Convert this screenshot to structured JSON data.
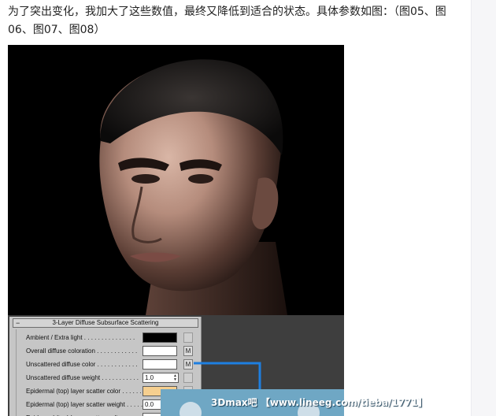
{
  "article": {
    "paragraph": "为了突出变化，我加大了这些数值，最终又降低到适合的状态。具体参数如图：（图05、图06、图07、图08）"
  },
  "rollout": {
    "title": "3-Layer Diffuse Subsurface Scattering",
    "rows": [
      {
        "label": "Ambient / Extra light . . . . . . . . . . . . . . .",
        "control": "swatch",
        "color": "#000000",
        "button": ""
      },
      {
        "label": "Overall diffuse coloration . . . . . . . . . . . .",
        "control": "swatch",
        "color": "#ffffff",
        "button": "M"
      },
      {
        "label": "Unscattered diffuse color . . . . . . . . . . . .",
        "control": "swatch",
        "color": "#ffffff",
        "button": "M"
      },
      {
        "label": "Unscattered diffuse weight . . . . . . . . . . .",
        "control": "spinner",
        "value": "1.0",
        "button": ""
      },
      {
        "label": "Epidermal (top) layer scatter color . . . . . .",
        "control": "swatch",
        "color": "#f6cf8f",
        "button": ""
      },
      {
        "label": "Epidermal (top) layer scatter weight . . . . .",
        "control": "spinner",
        "value": "0.0",
        "button": ""
      },
      {
        "label": "Epidermal (top) layer scatter radius . . . . .",
        "control": "spinner",
        "value": "",
        "button": ""
      }
    ]
  },
  "watermark": {
    "text": "3Dmax吧 【www.lineeg.com/tieba/1771】"
  },
  "colors": {
    "panel_bg": "#c6c6c6",
    "viewport_bg": "#3e3e3e",
    "wire": "#1e7fe0",
    "watermark_bg": "#6fa7c4"
  }
}
